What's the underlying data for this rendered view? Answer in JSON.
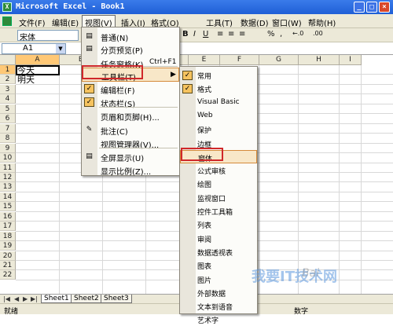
{
  "window": {
    "title": "Microsoft Excel - Book1"
  },
  "menubar": [
    "文件(F)",
    "编辑(E)",
    "视图(V)",
    "插入(I)",
    "格式(O)",
    "工具(T)",
    "数据(D)",
    "窗口(W)",
    "帮助(H)"
  ],
  "toolbar": {
    "font_name": "宋体",
    "buttons": [
      "B",
      "I",
      "U",
      "≡",
      "≡",
      "≡",
      "%",
      ",",
      "←.0",
      ".00"
    ]
  },
  "formula_bar": {
    "name_box": "A1"
  },
  "sheet": {
    "columns": [
      "A",
      "B",
      "C",
      "D",
      "E",
      "F",
      "G",
      "H",
      "I"
    ],
    "rows": [
      "1",
      "2",
      "3",
      "4",
      "5",
      "6",
      "7",
      "8",
      "9",
      "10",
      "11",
      "12",
      "13",
      "14",
      "15",
      "16",
      "17",
      "18",
      "19",
      "20",
      "21",
      "22"
    ],
    "cells": {
      "A1": "今天",
      "A2": "明天"
    }
  },
  "sheet_tabs": [
    "Sheet1",
    "Sheet2",
    "Sheet3"
  ],
  "status_bar": {
    "left": "就绪",
    "right": "数字"
  },
  "view_menu": [
    {
      "label": "普通(N)",
      "icon": "normal-view-icon"
    },
    {
      "label": "分页预览(P)",
      "icon": "page-break-icon"
    },
    {
      "label": "任务窗格(K)",
      "shortcut": "Ctrl+F1"
    },
    {
      "label": "工具栏(T)",
      "submenu": true,
      "highlighted": true
    },
    {
      "label": "编辑栏(F)",
      "checked": true
    },
    {
      "label": "状态栏(S)",
      "checked": true
    },
    {
      "label": "页眉和页脚(H)..."
    },
    {
      "label": "批注(C)",
      "icon": "comment-icon"
    },
    {
      "label": "视图管理器(V)..."
    },
    {
      "label": "全屏显示(U)",
      "icon": "fullscreen-icon"
    },
    {
      "label": "显示比例(Z)..."
    }
  ],
  "toolbars_submenu": [
    {
      "label": "常用",
      "checked": true
    },
    {
      "label": "格式",
      "checked": true
    },
    {
      "label": "Visual Basic"
    },
    {
      "label": "Web"
    },
    {
      "label": "保护"
    },
    {
      "label": "边框"
    },
    {
      "label": "窗体",
      "highlighted": true
    },
    {
      "label": "公式审核"
    },
    {
      "label": "绘图"
    },
    {
      "label": "监视窗口"
    },
    {
      "label": "控件工具箱"
    },
    {
      "label": "列表"
    },
    {
      "label": "审阅"
    },
    {
      "label": "数据透视表"
    },
    {
      "label": "图表"
    },
    {
      "label": "图片"
    },
    {
      "label": "外部数据"
    },
    {
      "label": "文本到语音"
    },
    {
      "label": "艺术字"
    }
  ],
  "watermark": {
    "text": "我要IT技术网",
    "brand": "Bai"
  },
  "colors": {
    "highlight_border": "#d0282a",
    "selected_header": "#ffc876",
    "title_bar": "#1f5fd6"
  }
}
